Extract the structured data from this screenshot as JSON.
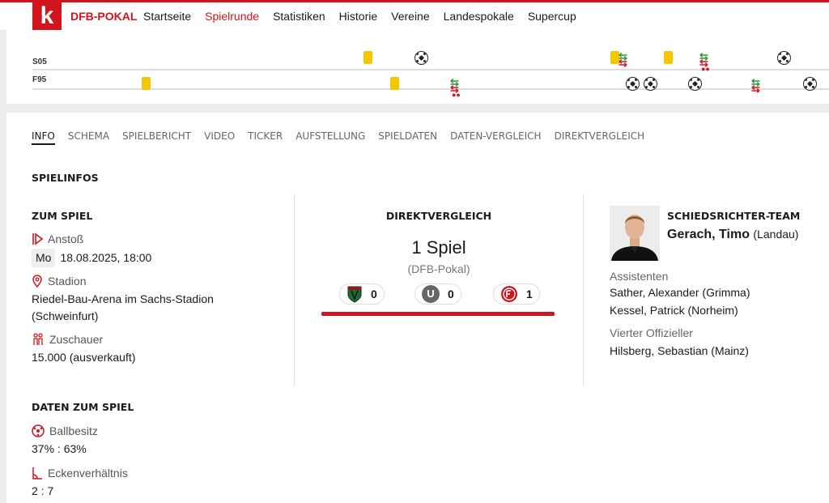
{
  "header": {
    "logo": "k",
    "brand": "DFB-POKAL",
    "nav": [
      "Startseite",
      "Spielrunde",
      "Statistiken",
      "Historie",
      "Vereine",
      "Landespokale",
      "Supercup"
    ]
  },
  "timeline": {
    "team1": "S05",
    "team2": "F95"
  },
  "tabs": [
    "INFO",
    "SCHEMA",
    "SPIELBERICHT",
    "VIDEO",
    "TICKER",
    "AUFSTELLUNG",
    "SPIELDATEN",
    "DATEN-VERGLEICH",
    "DIREKTVERGLEICH"
  ],
  "spielinfos_title": "SPIELINFOS",
  "zum_spiel": {
    "title": "ZUM SPIEL",
    "anstoss_label": "Anstoß",
    "anstoss_day": "Mo",
    "anstoss_value": "18.08.2025, 18:00",
    "stadion_label": "Stadion",
    "stadion_value": "Riedel-Bau-Arena im Sachs-Stadion (Schweinfurt)",
    "zuschauer_label": "Zuschauer",
    "zuschauer_value": "15.000 (ausverkauft)"
  },
  "daten": {
    "title": "DATEN ZUM SPIEL",
    "ballbesitz_label": "Ballbesitz",
    "ballbesitz_value": "37% : 63%",
    "ecken_label": "Eckenverhältnis",
    "ecken_value": "2 : 7"
  },
  "direkt": {
    "title": "DIREKTVERGLEICH",
    "count": "1",
    "count_label": "Spiel",
    "competition": "(DFB-Pokal)",
    "wins_team1": "0",
    "draw_letter": "U",
    "draws": "0",
    "wins_team2": "1"
  },
  "ref": {
    "title": "SCHIEDSRICHTER-TEAM",
    "name": "Gerach, Timo",
    "city": "(Landau)",
    "assistants_label": "Assistenten",
    "assistant1": "Sather, Alexander (Grimma)",
    "assistant2": "Kessel, Patrick (Norheim)",
    "fourth_label": "Vierter Offizieller",
    "fourth": "Hilsberg, Sebastian (Mainz)"
  },
  "colors": {
    "accent": "#d2151c",
    "yellow_card": "#f3c800",
    "sub_in": "#2e9a3a"
  }
}
